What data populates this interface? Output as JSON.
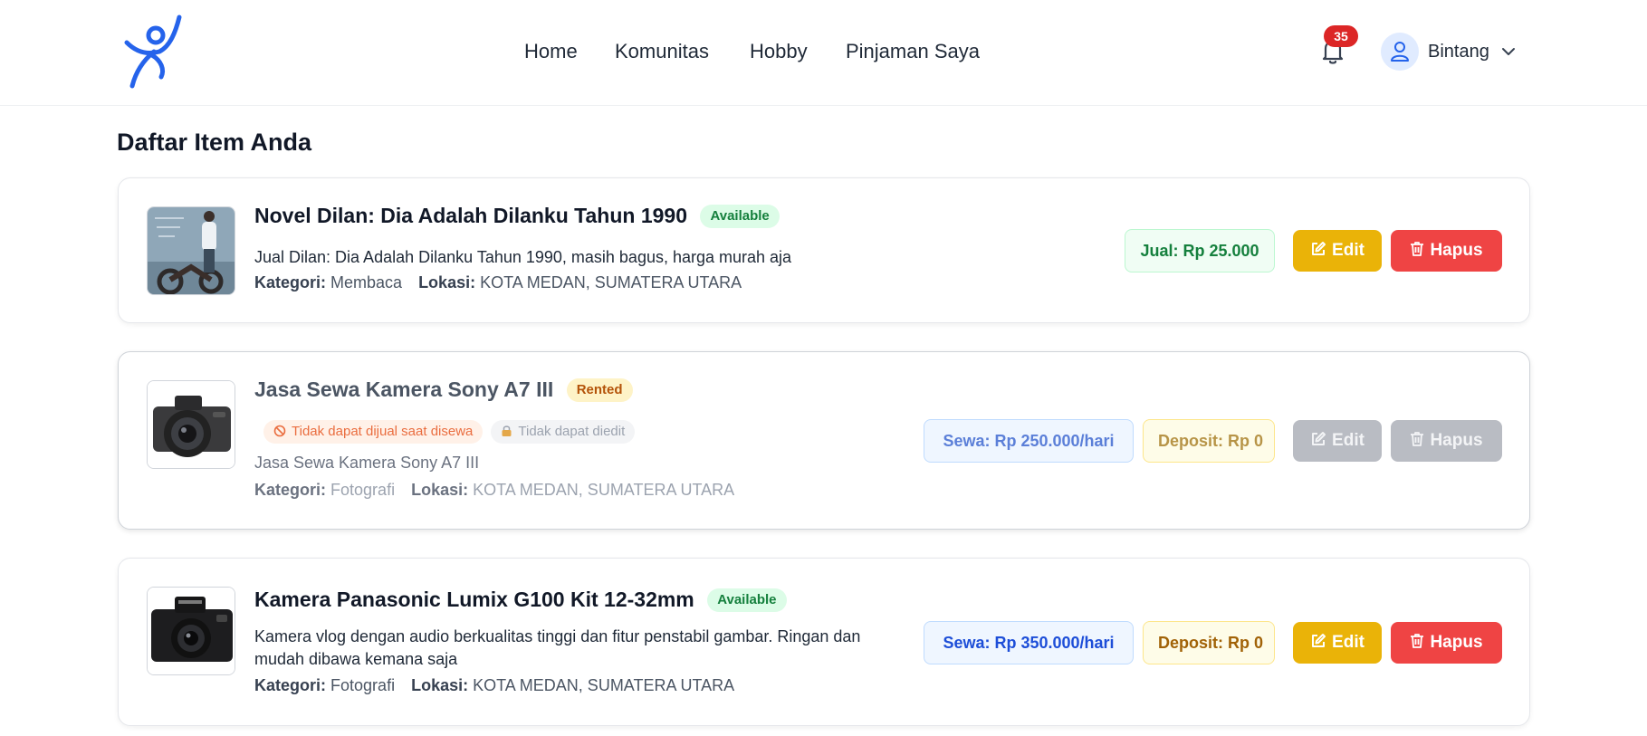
{
  "header": {
    "nav": [
      "Home",
      "Komunitas",
      "Hobby",
      "Pinjaman Saya"
    ],
    "notification_count": "35",
    "user_name": "Bintang",
    "accent": "#2563eb"
  },
  "page_title": "Daftar Item Anda",
  "items": [
    {
      "title": "Novel Dilan: Dia Adalah Dilanku Tahun 1990",
      "status": "Available",
      "description": "Jual Dilan: Dia Adalah Dilanku Tahun 1990, masih bagus, harga murah aja",
      "kategori_label": "Kategori:",
      "kategori": "Membaca",
      "lokasi_label": "Lokasi:",
      "lokasi": "KOTA MEDAN, SUMATERA UTARA",
      "price": "Jual: Rp 25.000",
      "edit_label": "Edit",
      "delete_label": "Hapus"
    },
    {
      "title": "Jasa Sewa Kamera Sony A7 III",
      "status": "Rented",
      "warnings": [
        "Tidak dapat dijual saat disewa",
        "Tidak dapat diedit"
      ],
      "description": "Jasa Sewa Kamera Sony A7 III",
      "kategori_label": "Kategori:",
      "kategori": "Fotografi",
      "lokasi_label": "Lokasi:",
      "lokasi": "KOTA MEDAN, SUMATERA UTARA",
      "price": "Sewa: Rp 250.000/hari",
      "deposit": "Deposit: Rp 0",
      "edit_label": "Edit",
      "delete_label": "Hapus"
    },
    {
      "title": "Kamera Panasonic Lumix G100 Kit 12-32mm",
      "status": "Available",
      "description": "Kamera vlog dengan audio berkualitas tinggi dan fitur penstabil gambar. Ringan dan mudah dibawa kemana saja",
      "kategori_label": "Kategori:",
      "kategori": "Fotografi",
      "lokasi_label": "Lokasi:",
      "lokasi": "KOTA MEDAN, SUMATERA UTARA",
      "price": "Sewa: Rp 350.000/hari",
      "deposit": "Deposit: Rp 0",
      "edit_label": "Edit",
      "delete_label": "Hapus"
    }
  ]
}
